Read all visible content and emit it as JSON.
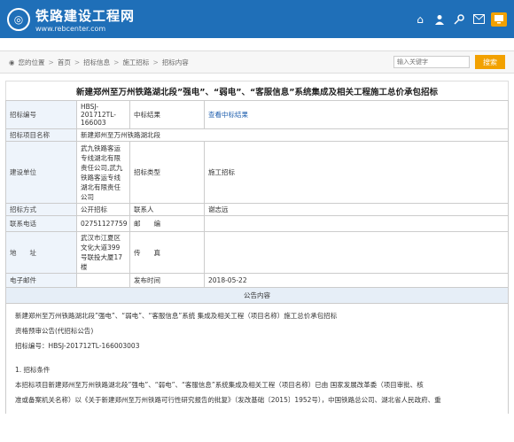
{
  "header": {
    "logo_mark": "◎",
    "site_name": "铁路建设工程网",
    "site_url": "www.rebcenter.com",
    "icons": [
      "home-icon",
      "user-icon",
      "key-icon",
      "mail-icon",
      "monitor-icon"
    ]
  },
  "breadcrumb": {
    "items": [
      "您的位置",
      "首页",
      "招标信息",
      "施工招标",
      "招标内容"
    ]
  },
  "search": {
    "placeholder": "输入关键字",
    "button_label": "搜索"
  },
  "notice": {
    "title": "新建郑州至万州铁路湖北段”强电”、“弱电”、“客服信息”系统集成及相关工程施工总价承包招标"
  },
  "table": {
    "row1": {
      "l1": "招标编号",
      "v1": "HBSJ-201712TL-166003",
      "l2": "中标结果",
      "v2": "查看中标结果"
    },
    "row2": {
      "l1": "招标项目名称",
      "v1": "新建郑州至万州铁路湖北段"
    },
    "row3": {
      "l1": "建设单位",
      "v1": "武九铁路客运专线湖北有限责任公司,武九铁路客运专线湖北有限责任公司",
      "l2": "招标类型",
      "v2": "施工招标"
    },
    "row4": {
      "l1": "招标方式",
      "v1": "公开招标",
      "l2": "联系人",
      "v2": "谢志远"
    },
    "row5": {
      "l1": "联系电话",
      "v1": "02751127759",
      "l2": "邮　　编",
      "v2": ""
    },
    "row6": {
      "l1": "地　　址",
      "v1": "武汉市江夏区文化大道399号联投大厦17楼",
      "l2": "传　　真",
      "v2": ""
    },
    "row7": {
      "l1": "电子邮件",
      "v1": "",
      "l2": "发布时间",
      "v2": "2018-05-22"
    },
    "section_header": "公告内容"
  },
  "content": {
    "p1": "新建郑州至万州铁路湖北段”强电”、“弱电”、“客服信息”系统 集成及相关工程（项目名称）施工总价承包招标",
    "p2": "资格预审公告(代招标公告)",
    "p3": "招标编号：HBSJ-201712TL-166003003",
    "p4": "1. 招标条件",
    "p5": "本招标项目新建郑州至万州铁路湖北段”强电”、“弱电”、“客服信息”系统集成及相关工程（项目名称）已由 国家发展改革委（项目审批、核",
    "p6": "准或备案机关名称）以《关于新建郑州至万州铁路可行性研究报告的批复》（发改基础〔2015〕1952号），中国铁路总公司、湖北省人民政府、重"
  }
}
